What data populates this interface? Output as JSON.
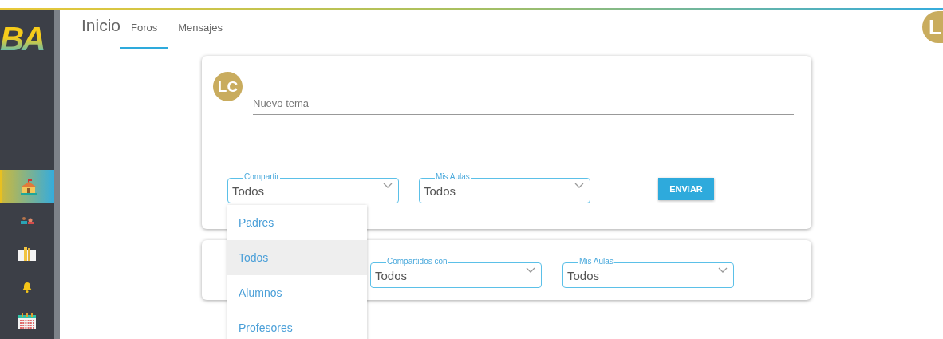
{
  "logo": "BA",
  "nav_items": [
    {
      "selected": true
    },
    {
      "selected": false
    },
    {
      "selected": false
    },
    {
      "selected": false
    },
    {
      "selected": false
    }
  ],
  "header": {
    "title": "Inicio",
    "tabs": [
      {
        "label": "Foros",
        "selected": true
      },
      {
        "label": "Mensajes",
        "selected": false
      }
    ],
    "user_avatar": "L"
  },
  "composer": {
    "avatar": "LC",
    "topic_field": {
      "placeholder": "Nuevo tema"
    },
    "selects": [
      {
        "label": "Compartir",
        "value": "Todos",
        "options": [
          {
            "label": "Padres",
            "selected": false
          },
          {
            "label": "Todos",
            "selected": true
          },
          {
            "label": "Alumnos",
            "selected": false
          },
          {
            "label": "Profesores",
            "selected": false
          }
        ]
      },
      {
        "label": "Mis Aulas",
        "value": "Todos"
      }
    ],
    "send_button": "ENVIAR"
  },
  "filters": {
    "selects": [
      {
        "label": "Compartidos con",
        "value": "Todos"
      },
      {
        "label": "Mis Aulas",
        "value": "Todos"
      }
    ]
  }
}
